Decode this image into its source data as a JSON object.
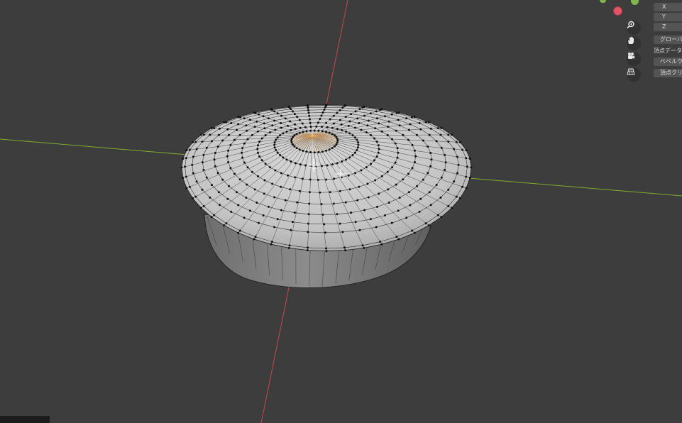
{
  "viewport": {
    "background": "#3d3d3d",
    "axis_x_color": "#c44a4a",
    "axis_y_color": "#7fae2e",
    "mesh_color": "#c8c8c8",
    "vertex_color": "#111111"
  },
  "gizmo": {
    "axis_colors": [
      "#7fb84a",
      "#e05566",
      "#7fb84a"
    ]
  },
  "nav_buttons": [
    {
      "icon": "zoom-icon"
    },
    {
      "icon": "hand-icon"
    },
    {
      "icon": "camera-icon"
    },
    {
      "icon": "grid-icon"
    }
  ],
  "n_panel": {
    "x_label": "X",
    "y_label": "Y",
    "z_label": "Z",
    "global_button": "グローバ",
    "vertex_data_label": "頂点データ",
    "bevel_button": "ベベルウ",
    "vertex_crease_button": "頂点クリ"
  }
}
